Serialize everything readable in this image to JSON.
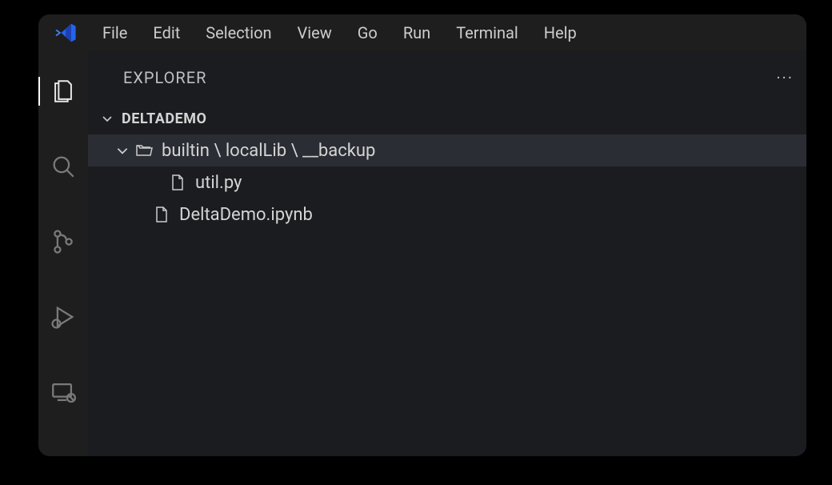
{
  "menubar": {
    "items": [
      {
        "label": "File"
      },
      {
        "label": "Edit"
      },
      {
        "label": "Selection"
      },
      {
        "label": "View"
      },
      {
        "label": "Go"
      },
      {
        "label": "Run"
      },
      {
        "label": "Terminal"
      },
      {
        "label": "Help"
      }
    ]
  },
  "sidebar": {
    "title": "EXPLORER",
    "section": "DELTADEMO",
    "folder_path": "builtin \\ localLib \\ __backup",
    "files": {
      "util": "util.py",
      "notebook": "DeltaDemo.ipynb"
    }
  },
  "colors": {
    "vscode_blue": "#3b82f6"
  }
}
